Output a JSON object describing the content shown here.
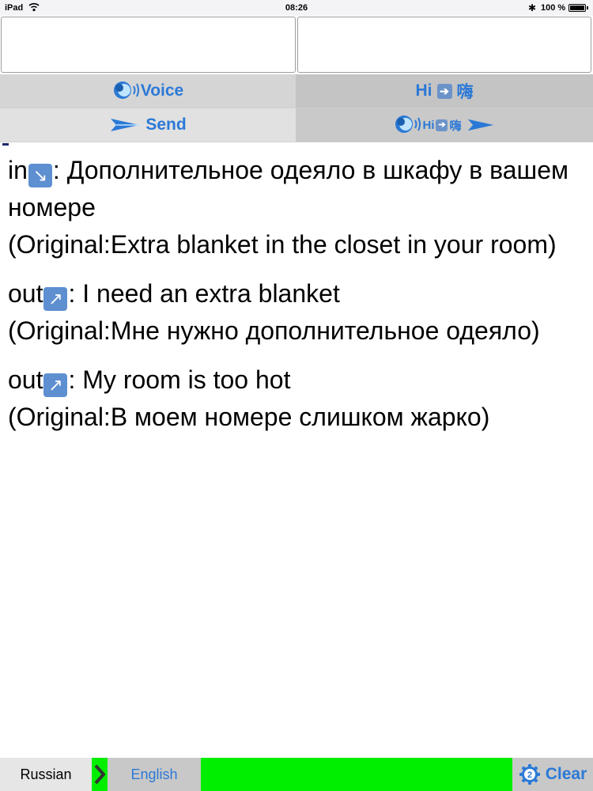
{
  "status_bar": {
    "device": "iPad",
    "time": "08:26",
    "battery": "100 %",
    "battery_level": 1.0
  },
  "inputs": {
    "left_value": "",
    "right_value": ""
  },
  "buttons": {
    "voice": "Voice",
    "hi_label": "Hi",
    "hi_target": "嗨",
    "send": "Send",
    "combo_hi": "Hi",
    "combo_target": "嗨"
  },
  "conversation": [
    {
      "direction": "in",
      "direction_icon": "arrow-down-right-icon",
      "text": ": Дополнительное одеяло в шкафу в вашем номере",
      "original": "(Original:Extra blanket in the closet in your room)"
    },
    {
      "direction": "out",
      "direction_icon": "arrow-up-right-icon",
      "text": ": I need an extra blanket",
      "original": "(Original:Мне нужно дополнительное одеяло)"
    },
    {
      "direction": "out",
      "direction_icon": "arrow-up-right-icon",
      "text": ": My room is too hot",
      "original": "(Original:В моем номере слишком жарко)"
    }
  ],
  "bottom_bar": {
    "source_language": "Russian",
    "target_language": "English",
    "clear_label": "Clear",
    "clear_badge": "2"
  },
  "colors": {
    "accent": "#2b79d6",
    "green": "#00ee00",
    "icon_blue": "#5d8fd1"
  }
}
